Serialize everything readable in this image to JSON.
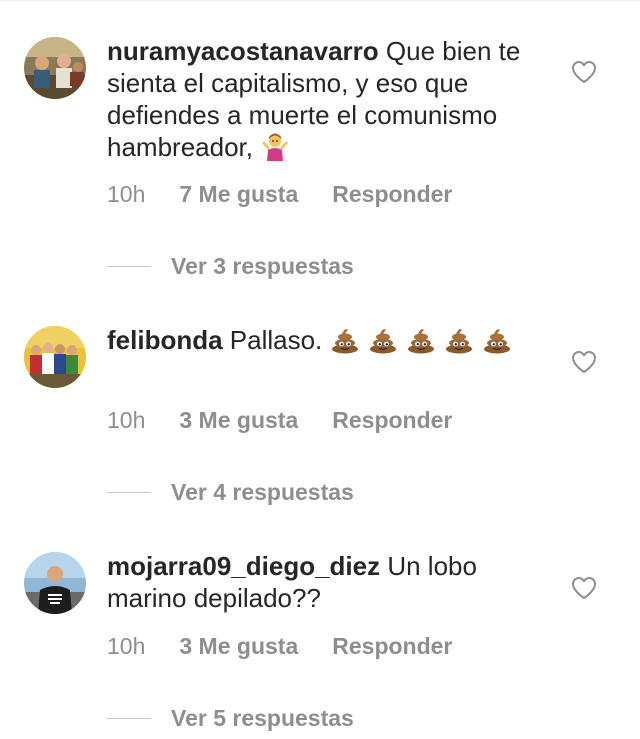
{
  "comments": [
    {
      "username": "nuramyacostanavarro",
      "text": " Que bien te sienta el capitalismo, y eso que defiendes a muerte el comunismo hambreador, ",
      "emoji_after": "woman-shrugging-emoji",
      "time": "10h",
      "likes": "7 Me gusta",
      "reply": "Responder",
      "view_replies": "Ver 3 respuestas",
      "avatar_icon": "user-avatar-group-photo"
    },
    {
      "username": "felibonda",
      "text": " Pallaso. ",
      "emoji_after": "pile-of-poo-emoji",
      "emoji_count": 5,
      "time": "10h",
      "likes": "3 Me gusta",
      "reply": "Responder",
      "view_replies": "Ver 4 respuestas",
      "avatar_icon": "user-avatar-group-photo"
    },
    {
      "username": "mojarra09_diego_diez",
      "text": " Un lobo marino depilado??",
      "time": "10h",
      "likes": "3 Me gusta",
      "reply": "Responder",
      "view_replies": "Ver 5 respuestas",
      "avatar_icon": "user-avatar-person-photo"
    }
  ],
  "icons": {
    "like": "heart-outline-icon"
  },
  "colors": {
    "text": "#262626",
    "secondary": "#8e8e8e",
    "divider": "#c7c7c7"
  }
}
